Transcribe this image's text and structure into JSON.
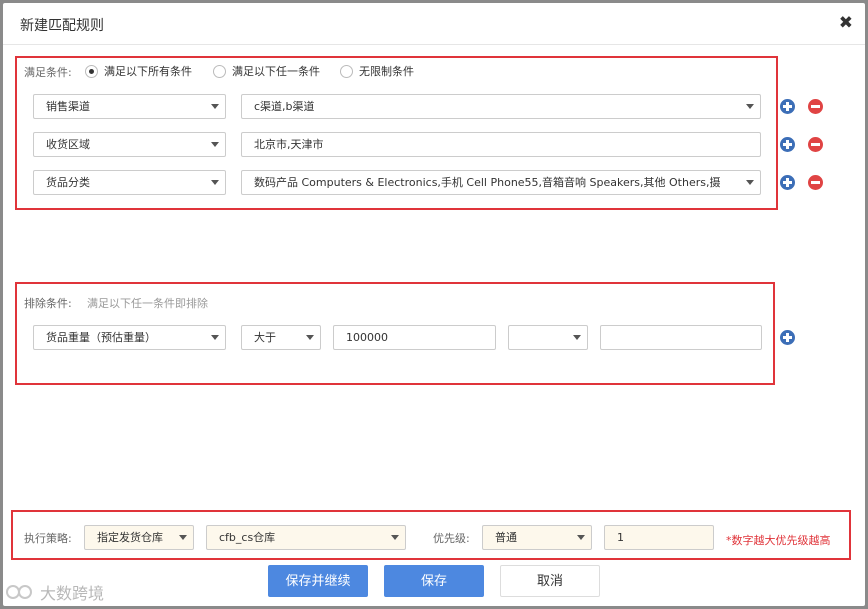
{
  "dialog": {
    "title": "新建匹配规则",
    "close_glyph": "✖"
  },
  "match_conditions": {
    "label": "满足条件:",
    "radio_options": [
      {
        "label": "满足以下所有条件",
        "checked": true
      },
      {
        "label": "满足以下任一条件",
        "checked": false
      },
      {
        "label": "无限制条件",
        "checked": false
      }
    ],
    "rows": [
      {
        "field": "销售渠道",
        "value": "c渠道,b渠道",
        "value_has_dropdown": true
      },
      {
        "field": "收货区域",
        "value": "北京市,天津市",
        "value_has_dropdown": false
      },
      {
        "field": "货品分类",
        "value": "数码产品 Computers & Electronics,手机 Cell Phone55,音箱音响 Speakers,其他 Others,摄",
        "value_has_dropdown": true
      }
    ]
  },
  "exclude_conditions": {
    "label": "排除条件:",
    "hint": "满足以下任一条件即排除",
    "row": {
      "field": "货品重量（预估重量）",
      "operator": "大于",
      "value": "100000",
      "unit": "",
      "extra": ""
    }
  },
  "strategy": {
    "label": "执行策略:",
    "strategy_select": "指定发货仓库",
    "warehouse_select": "cfb_cs仓库",
    "priority_label": "优先级:",
    "priority_select": "普通",
    "priority_value": "1",
    "priority_hint": "*数字越大优先级越高"
  },
  "footer": {
    "save_continue": "保存并继续",
    "save": "保存",
    "cancel": "取消"
  },
  "watermark": {
    "text": "大数跨境"
  },
  "icons": {
    "add": "plus-circle-icon",
    "remove": "minus-circle-icon",
    "dropdown": "chevron-down-icon"
  },
  "colors": {
    "primary": "#4d88e0",
    "highlight_border": "#e0343a",
    "add_icon": "#3c6eb7",
    "remove_icon": "#e04444"
  }
}
